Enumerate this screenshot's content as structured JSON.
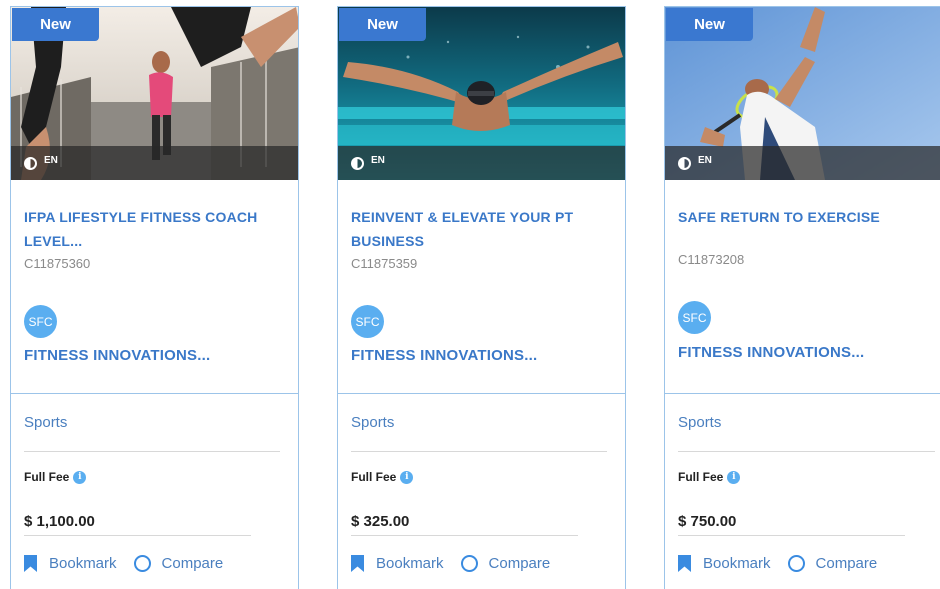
{
  "cards": [
    {
      "badge": "New",
      "language": "EN",
      "title": "IFPA LIFESTYLE FITNESS COACH LEVEL...",
      "code": "C11875360",
      "provider_badge": "SFC",
      "provider": "FITNESS INNOVATIONS...",
      "category": "Sports",
      "fee_label": "Full Fee",
      "price": "$ 1,100.00",
      "bookmark_label": "Bookmark",
      "compare_label": "Compare"
    },
    {
      "badge": "New",
      "language": "EN",
      "title": "REINVENT & ELEVATE YOUR PT BUSINESS",
      "code": "C11875359",
      "provider_badge": "SFC",
      "provider": "FITNESS INNOVATIONS...",
      "category": "Sports",
      "fee_label": "Full Fee",
      "price": "$ 325.00",
      "bookmark_label": "Bookmark",
      "compare_label": "Compare"
    },
    {
      "badge": "New",
      "language": "EN",
      "title": "SAFE RETURN TO EXERCISE",
      "code": "C11873208",
      "provider_badge": "SFC",
      "provider": "FITNESS INNOVATIONS...",
      "category": "Sports",
      "fee_label": "Full Fee",
      "price": "$ 750.00",
      "bookmark_label": "Bookmark",
      "compare_label": "Compare"
    }
  ],
  "colors": {
    "accent": "#3a78c8",
    "badge": "#3a78d0",
    "border": "#9cc4e9",
    "sfc": "#5aaef0"
  }
}
